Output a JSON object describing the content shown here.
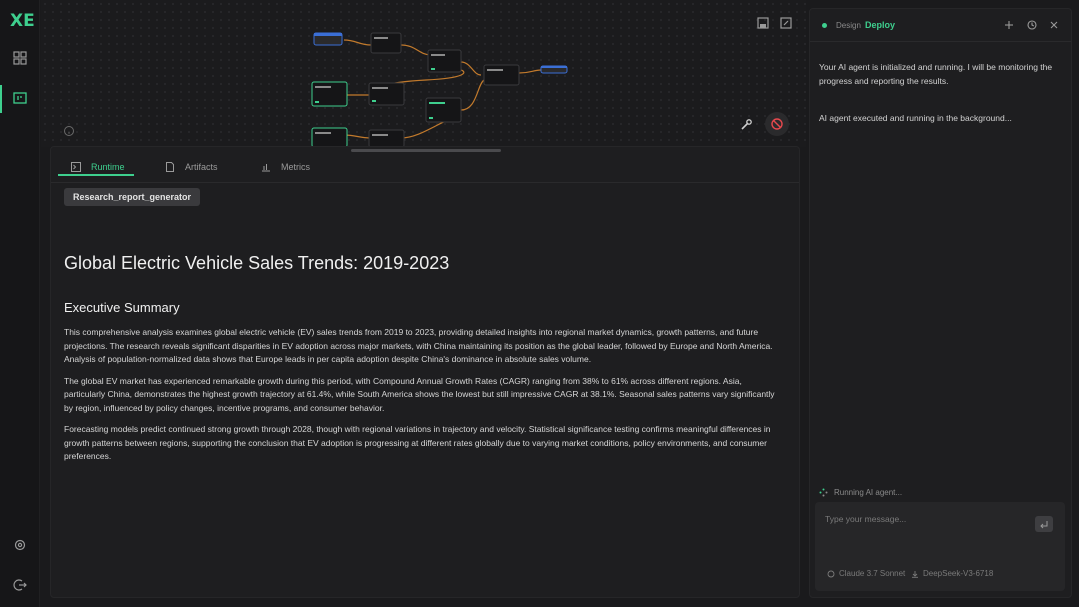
{
  "app": {
    "logo_text": "XE"
  },
  "tabs": [
    {
      "label": "Runtime",
      "icon": "terminal-icon",
      "active": true
    },
    {
      "label": "Artifacts",
      "icon": "file-icon",
      "active": false
    },
    {
      "label": "Metrics",
      "icon": "bar-chart-icon",
      "active": false
    }
  ],
  "agent_chip": "Research_report_generator",
  "report": {
    "title": "Global Electric Vehicle Sales Trends: 2019-2023",
    "section_heading": "Executive Summary",
    "paragraphs": [
      "This comprehensive analysis examines global electric vehicle (EV) sales trends from 2019 to 2023, providing detailed insights into regional market dynamics, growth patterns, and future projections. The research reveals significant disparities in EV adoption across major markets, with China maintaining its position as the global leader, followed by Europe and North America. Analysis of population-normalized data shows that Europe leads in per capita adoption despite China's dominance in absolute sales volume.",
      "The global EV market has experienced remarkable growth during this period, with Compound Annual Growth Rates (CAGR) ranging from 38% to 61% across different regions. Asia, particularly China, demonstrates the highest growth trajectory at 61.4%, while South America shows the lowest but still impressive CAGR at 38.1%. Seasonal sales patterns vary significantly by region, influenced by policy changes, incentive programs, and consumer behavior.",
      "Forecasting models predict continued strong growth through 2028, though with regional variations in trajectory and velocity. Statistical significance testing confirms meaningful differences in growth patterns between regions, supporting the conclusion that EV adoption is progressing at different rates globally due to varying market conditions, policy environments, and consumer preferences."
    ]
  },
  "chat": {
    "mode_design": "Design",
    "mode_deploy": "Deploy",
    "messages": [
      "Your AI agent is initialized and running. I will be monitoring the progress and reporting the results.",
      "AI agent executed and running in the background..."
    ],
    "status": "Running AI agent...",
    "input_placeholder": "Type your message...",
    "models": [
      "Claude 3.7 Sonnet",
      "DeepSeek-V3-6718"
    ]
  },
  "colors": {
    "accent": "#3ecf8e",
    "stop": "#e5484d",
    "node_blue": "#3b6fd6"
  }
}
